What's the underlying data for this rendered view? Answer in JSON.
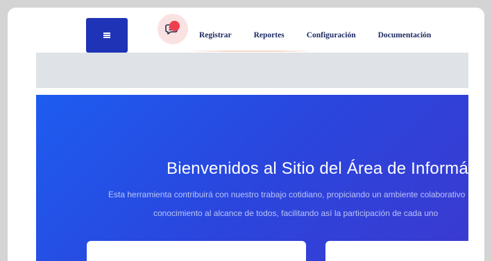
{
  "nav": {
    "items": [
      "Registrar",
      "Reportes",
      "Configuración",
      "Documentación"
    ]
  },
  "hero": {
    "title": "Bienvenidos al Sitio del Área de Informática",
    "line1": "Esta herramienta contribuirá con nuestro trabajo cotidiano, propiciando un ambiente colaborativo",
    "line2": "conocimiento al alcance de todos, facilitando así la participación de cada uno"
  },
  "icons": {
    "menu": "menu-icon",
    "chat": "chat-icon",
    "notification": "notification-dot-icon"
  },
  "colors": {
    "menu_button": "#1f33b6",
    "nav_text": "#1d2a63",
    "hero_start": "#1e5cf0",
    "hero_end": "#3b39d0",
    "notification": "#ef3e4f",
    "band": "#dfe2e6"
  }
}
